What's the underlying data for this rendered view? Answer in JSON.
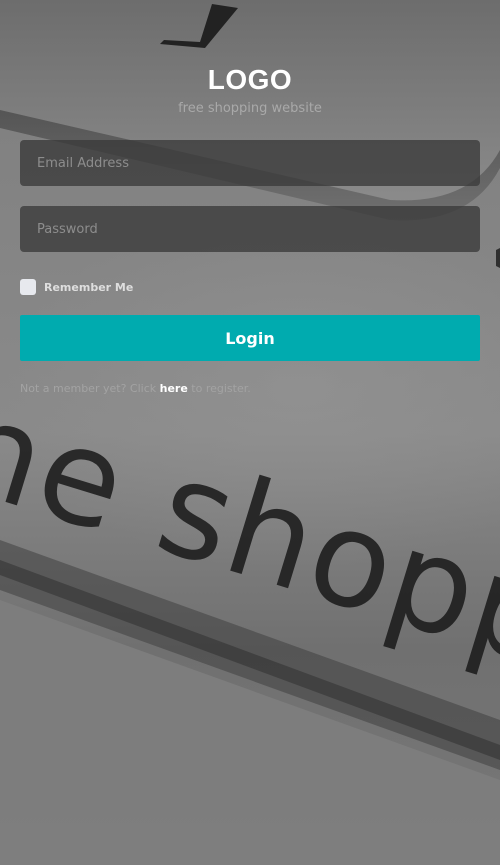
{
  "header": {
    "logo": "LOGO",
    "tagline": "free shopping website"
  },
  "form": {
    "email_placeholder": "Email Address",
    "password_placeholder": "Password",
    "remember_label": "Remember Me",
    "remember_checked": false,
    "login_label": "Login"
  },
  "footer": {
    "register_prefix": "Not a member yet? Click ",
    "register_link": "here",
    "register_suffix": " to register."
  },
  "colors": {
    "accent": "#00abaf",
    "field_background": "#3a3a3a",
    "background": "#7b7b7b"
  },
  "background": {
    "photo_text": "ne shopp"
  }
}
